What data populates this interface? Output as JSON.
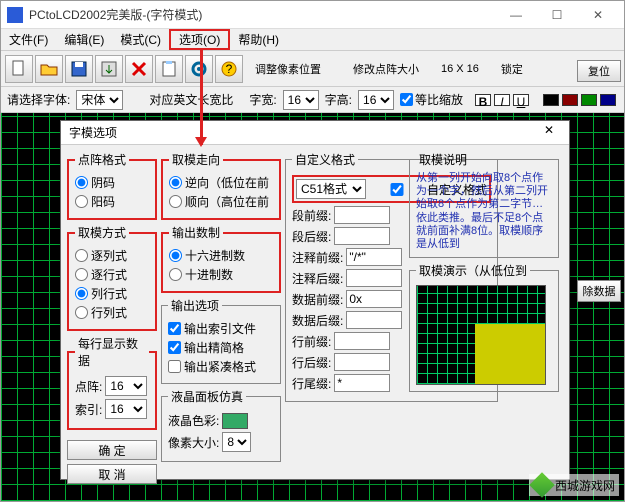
{
  "window": {
    "title": "PCtoLCD2002完美版-(字符模式)",
    "controls": {
      "min": "—",
      "max": "☐",
      "close": "✕"
    }
  },
  "menubar": [
    "文件(F)",
    "编辑(E)",
    "模式(C)",
    "选项(O)",
    "帮助(H)"
  ],
  "menubar_highlight": 3,
  "toolbar_sections": {
    "adjust_pixel": "调整像素位置",
    "modify_size": "修改点阵大小",
    "size_display": "16 X 16",
    "lock": "锁定"
  },
  "optrow": {
    "select_font_label": "请选择字体:",
    "font_value": "宋体",
    "ratio_label": "对应英文长宽比",
    "width_label": "字宽:",
    "width_value": "16",
    "height_label": "字高:",
    "height_value": "16",
    "scale_chk": "等比缩放"
  },
  "side_buttons": {
    "reset": "复位",
    "clear": "除数据"
  },
  "dialog": {
    "title": "字模选项",
    "close": "✕",
    "group_pattern": {
      "legend": "点阵格式",
      "opts": [
        "阴码",
        "阳码"
      ],
      "sel": 0
    },
    "group_method": {
      "legend": "取模方式",
      "opts": [
        "逐列式",
        "逐行式",
        "列行式",
        "行列式"
      ],
      "sel": 2
    },
    "group_display": {
      "legend": "每行显示数据",
      "dot_label": "点阵:",
      "dot_value": "16",
      "idx_label": "索引:",
      "idx_value": "16"
    },
    "btn_ok": "确 定",
    "btn_cancel": "取 消",
    "group_direction": {
      "legend": "取模走向",
      "opts": [
        "逆向（低位在前",
        "顺向（高位在前"
      ],
      "sel": 0
    },
    "group_radix": {
      "legend": "输出数制",
      "opts": [
        "十六进制数",
        "十进制数"
      ],
      "sel": 0
    },
    "group_output": {
      "legend": "输出选项",
      "opts": [
        "输出索引文件",
        "输出精简格",
        "输出紧凑格式"
      ],
      "chk": [
        true,
        true,
        false
      ]
    },
    "group_lcd": {
      "legend": "液晶面板仿真",
      "color_label": "液晶色彩:",
      "pixel_label": "像素大小:",
      "pixel_value": "8"
    },
    "group_custom": {
      "legend": "自定义格式",
      "format_value": "C51格式",
      "custom_chk": "自定义格式",
      "rows": [
        {
          "l": "段前缀:",
          "v": ""
        },
        {
          "l": "段后缀:",
          "v": ""
        },
        {
          "l": "注释前缀:",
          "v": "\"/*\""
        },
        {
          "l": "注释后缀:",
          "v": ""
        },
        {
          "l": "数据前缀:",
          "v": "0x"
        },
        {
          "l": "数据后缀:",
          "v": ""
        },
        {
          "l": "行前缀:",
          "v": ""
        },
        {
          "l": "行后缀:",
          "v": ""
        },
        {
          "l": "行尾缀:",
          "v": "*"
        }
      ]
    },
    "group_explain": {
      "legend": "取模说明",
      "text": "从第一列开始向取8个点作为一个字，然后从第二列开始取8个点作为第二字节…依此类推。最后不足8个点就前面补满8位。取模顺序是从低到"
    },
    "group_demo": {
      "legend": "取模演示（从低位到"
    }
  },
  "watermark": "西城游戏网"
}
